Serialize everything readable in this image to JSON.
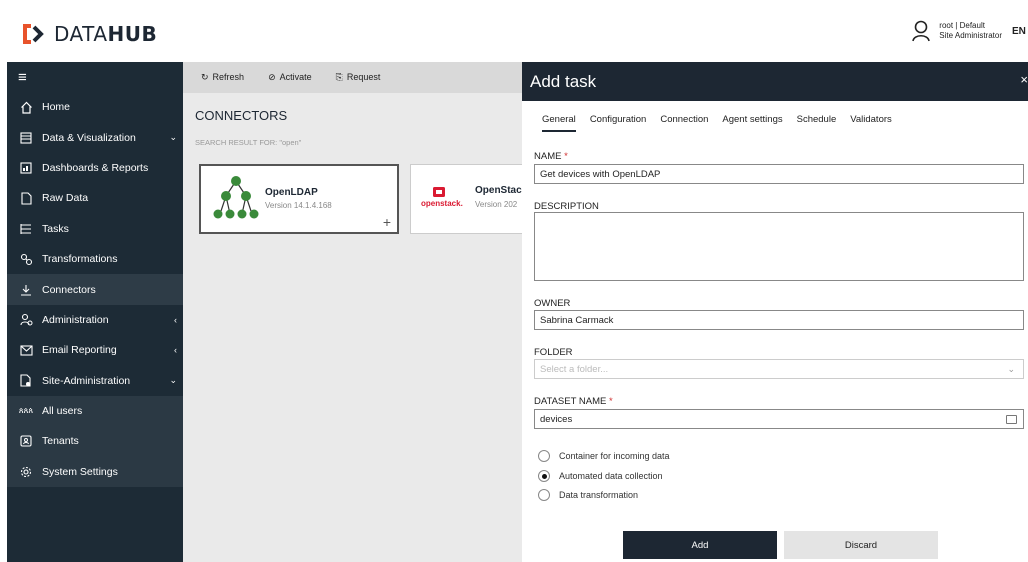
{
  "header": {
    "logo_prefix": "DATA",
    "logo_suffix": "HUB",
    "user_name": "root | Default",
    "user_role": "Site Administrator",
    "language": "EN"
  },
  "sidebar": {
    "menu_icon": "hamburger-icon",
    "items": [
      {
        "label": "Home",
        "icon": "home-icon"
      },
      {
        "label": "Data & Visualization",
        "icon": "grid-icon",
        "arrow": "⌄"
      },
      {
        "label": "Dashboards & Reports",
        "icon": "dashboard-icon"
      },
      {
        "label": "Raw Data",
        "icon": "file-icon"
      },
      {
        "label": "Tasks",
        "icon": "list-icon"
      },
      {
        "label": "Transformations",
        "icon": "transform-icon"
      },
      {
        "label": "Connectors",
        "icon": "download-icon"
      },
      {
        "label": "Administration",
        "icon": "admin-icon",
        "arrow": "‹"
      },
      {
        "label": "Email Reporting",
        "icon": "mail-icon",
        "arrow": "‹"
      },
      {
        "label": "Site-Administration",
        "icon": "site-admin-icon",
        "arrow": "⌄"
      },
      {
        "label": "All users",
        "icon": "users-icon"
      },
      {
        "label": "Tenants",
        "icon": "tenant-icon"
      },
      {
        "label": "System Settings",
        "icon": "gear-icon"
      }
    ]
  },
  "toolbar": {
    "refresh": "Refresh",
    "activate": "Activate",
    "request": "Request"
  },
  "connectors": {
    "title": "CONNECTORS",
    "search_result": "SEARCH RESULT FOR: \"open\"",
    "cards": [
      {
        "name": "OpenLDAP",
        "version": "Version 14.1.4.168"
      },
      {
        "name": "OpenStack",
        "version": "Version 202",
        "logo_text": "openstack."
      }
    ]
  },
  "panel": {
    "title": "Add task",
    "close": "×",
    "tabs": [
      "General",
      "Configuration",
      "Connection",
      "Agent settings",
      "Schedule",
      "Validators"
    ],
    "name_label": "NAME",
    "name_value": "Get devices with OpenLDAP",
    "description_label": "DESCRIPTION",
    "description_value": "",
    "owner_label": "OWNER",
    "owner_value": "Sabrina Carmack",
    "folder_label": "FOLDER",
    "folder_placeholder": "Select a folder...",
    "dataset_label": "DATASET NAME",
    "dataset_value": "devices",
    "required_marker": "*",
    "radios": [
      {
        "label": "Container for incoming data",
        "selected": false
      },
      {
        "label": "Automated data collection",
        "selected": true
      },
      {
        "label": "Data transformation",
        "selected": false
      }
    ],
    "add_label": "Add",
    "discard_label": "Discard"
  },
  "colors": {
    "navy": "#1d2733",
    "sidebar_bg": "#1d2b36",
    "required": "#d03030"
  }
}
